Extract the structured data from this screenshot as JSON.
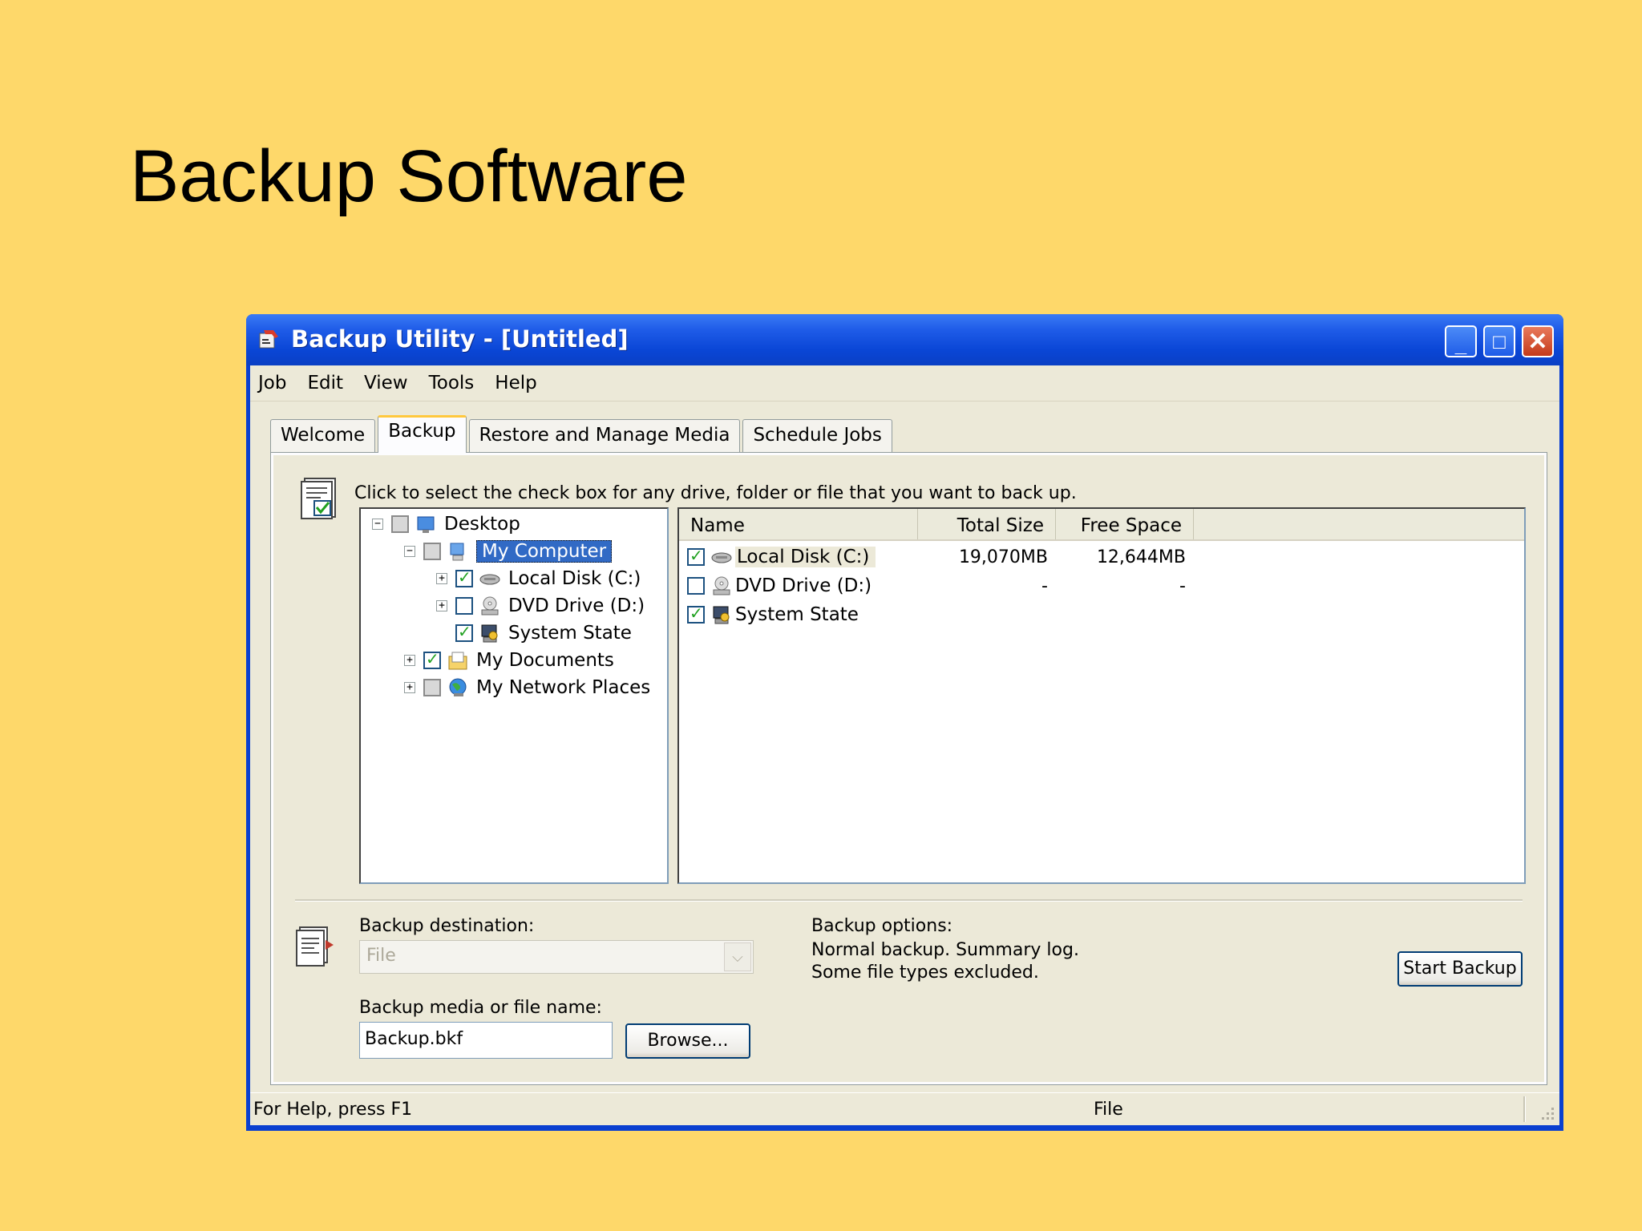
{
  "slide": {
    "title": "Backup Software"
  },
  "window": {
    "title": "Backup Utility - [Untitled]",
    "minimize_label": "_",
    "maximize_label": "□",
    "close_label": "✕"
  },
  "menu": [
    "Job",
    "Edit",
    "View",
    "Tools",
    "Help"
  ],
  "tabs": [
    "Welcome",
    "Backup",
    "Restore and Manage Media",
    "Schedule Jobs"
  ],
  "instruction": "Click to select the check box for any drive, folder or file that you want to back up.",
  "tree": {
    "desktop": "Desktop",
    "my_computer": "My Computer",
    "local_disk": "Local Disk (C:)",
    "dvd_drive": "DVD Drive (D:)",
    "system_state": "System State",
    "my_documents": "My Documents",
    "my_network_places": "My Network Places",
    "expand_symbol": "+",
    "collapse_symbol": "−"
  },
  "list": {
    "columns": [
      "Name",
      "Total Size",
      "Free Space"
    ],
    "rows": [
      {
        "name": "Local Disk (C:)",
        "total": "19,070MB",
        "free": "12,644MB",
        "checked": true
      },
      {
        "name": "DVD Drive (D:)",
        "total": "-",
        "free": "-",
        "checked": false
      },
      {
        "name": "System State",
        "total": "",
        "free": "",
        "checked": true
      }
    ]
  },
  "destination": {
    "label": "Backup destination:",
    "value": "File",
    "arrow": "⌵"
  },
  "media": {
    "label": "Backup media or file name:",
    "value": "Backup.bkf",
    "browse": "Browse..."
  },
  "options": {
    "label": "Backup options:",
    "line1": "Normal backup.  Summary log.",
    "line2": "Some file types excluded."
  },
  "start_backup": "Start Backup",
  "status": {
    "help": "For Help, press F1",
    "mode": "File"
  }
}
